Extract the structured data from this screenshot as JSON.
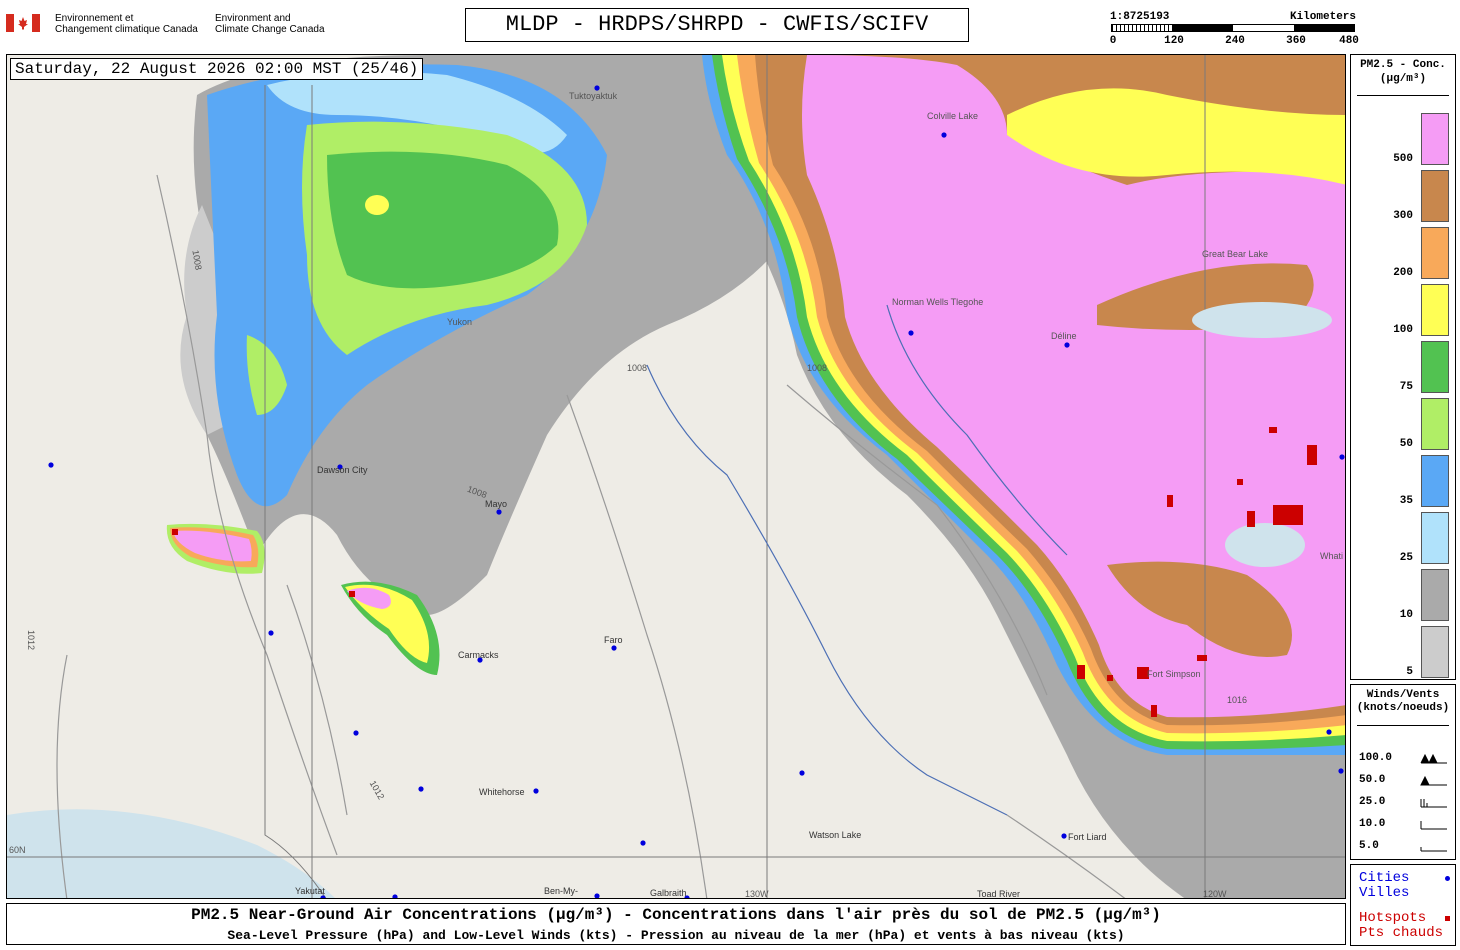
{
  "header": {
    "agency_fr": "Environnement et\nChangement climatique Canada",
    "agency_en": "Environment and\nClimate Change Canada",
    "title": "MLDP - HRDPS/SHRPD - CWFIS/SCIFV",
    "scale_ratio": "1:8725193",
    "scale_unit": "Kilometers",
    "scale_ticks": [
      "0",
      "120",
      "240",
      "360",
      "480"
    ]
  },
  "map": {
    "timestamp": "Saturday, 22 August 2026 02:00 MST (25/46)",
    "places": [
      "Tuktoyaktuk",
      "Colville Lake",
      "Norman Wells Tlegohe",
      "Déline",
      "Dawson City",
      "Mayo",
      "Carmacks",
      "Faro",
      "Whitehorse",
      "Watson Lake",
      "Fort Liard",
      "Yakutat",
      "Ben-My-",
      "Galbraith",
      "Toad River",
      "Great Bear Lake",
      "Whati",
      "Fort Simpson",
      "Yukon"
    ],
    "isobar_labels": [
      "1008",
      "1012",
      "1016"
    ],
    "longitude_labels": [
      "130W",
      "120W",
      "60N"
    ],
    "colors": {
      "land": "#eeece6",
      "water": "#cfe3ec",
      "pink": "#f59cf5",
      "brown": "#c8874d",
      "orange": "#f8a95a",
      "yellow": "#ffff55",
      "green_dark": "#52c251",
      "green_light": "#b0ee66",
      "blue": "#5aa8f5",
      "blue_light": "#b0e2fb",
      "gray_mid": "#aaaaaa",
      "gray_light": "#cccccc",
      "hotspot": "#cc0000",
      "city": "#0000dd"
    }
  },
  "legend_pm": {
    "title": "PM2.5 - Conc.\n(µg/m³)",
    "levels": [
      {
        "label": "500",
        "color": "#f59cf5"
      },
      {
        "label": "300",
        "color": "#c8874d"
      },
      {
        "label": "200",
        "color": "#f8a95a"
      },
      {
        "label": "100",
        "color": "#ffff55"
      },
      {
        "label": "75",
        "color": "#52c251"
      },
      {
        "label": "50",
        "color": "#b0ee66"
      },
      {
        "label": "35",
        "color": "#5aa8f5"
      },
      {
        "label": "25",
        "color": "#b0e2fb"
      },
      {
        "label": "10",
        "color": "#aaaaaa"
      },
      {
        "label": "5",
        "color": "#cccccc"
      }
    ]
  },
  "legend_wind": {
    "title": "Winds/Vents\n(knots/noeuds)",
    "rows": [
      "100.0",
      "50.0",
      "25.0",
      "10.0",
      "5.0"
    ]
  },
  "legend_misc": {
    "cities": "Cities\nVilles",
    "hotspots": "Hotspots\nPts chauds"
  },
  "caption": {
    "line1": "PM2.5 Near-Ground Air Concentrations (µg/m³) - Concentrations dans l'air près du sol de PM2.5 (µg/m³)",
    "line2": "Sea-Level Pressure (hPa) and Low-Level Winds (kts) - Pression au niveau de la mer (hPa) et vents à bas niveau (kts)"
  }
}
